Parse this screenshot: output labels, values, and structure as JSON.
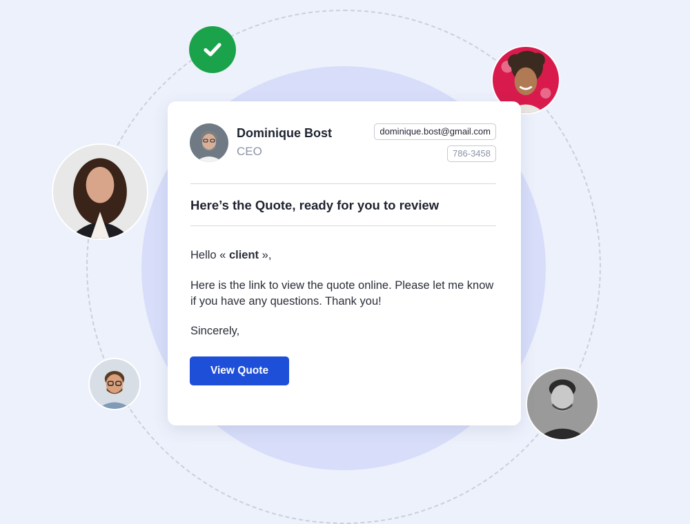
{
  "colors": {
    "background": "#edf1fc",
    "halo": "#d8defa",
    "check_badge": "#1aa34a",
    "button": "#1e4fd8",
    "avatar_pink_bg": "#d81b4c"
  },
  "badge": {
    "icon": "check-icon"
  },
  "sender": {
    "name": "Dominique Bost",
    "role": "CEO",
    "email": "dominique.bost@gmail.com",
    "phone": "786-3458"
  },
  "email": {
    "subject": "Here’s the Quote, ready for you to review",
    "greeting_prefix": "Hello « ",
    "greeting_name": "client",
    "greeting_suffix": " »,",
    "body": "Here is the link to view the quote online. Please let me know if you have any questions. Thank you!",
    "signoff": "Sincerely,",
    "button_label": "View Quote"
  }
}
